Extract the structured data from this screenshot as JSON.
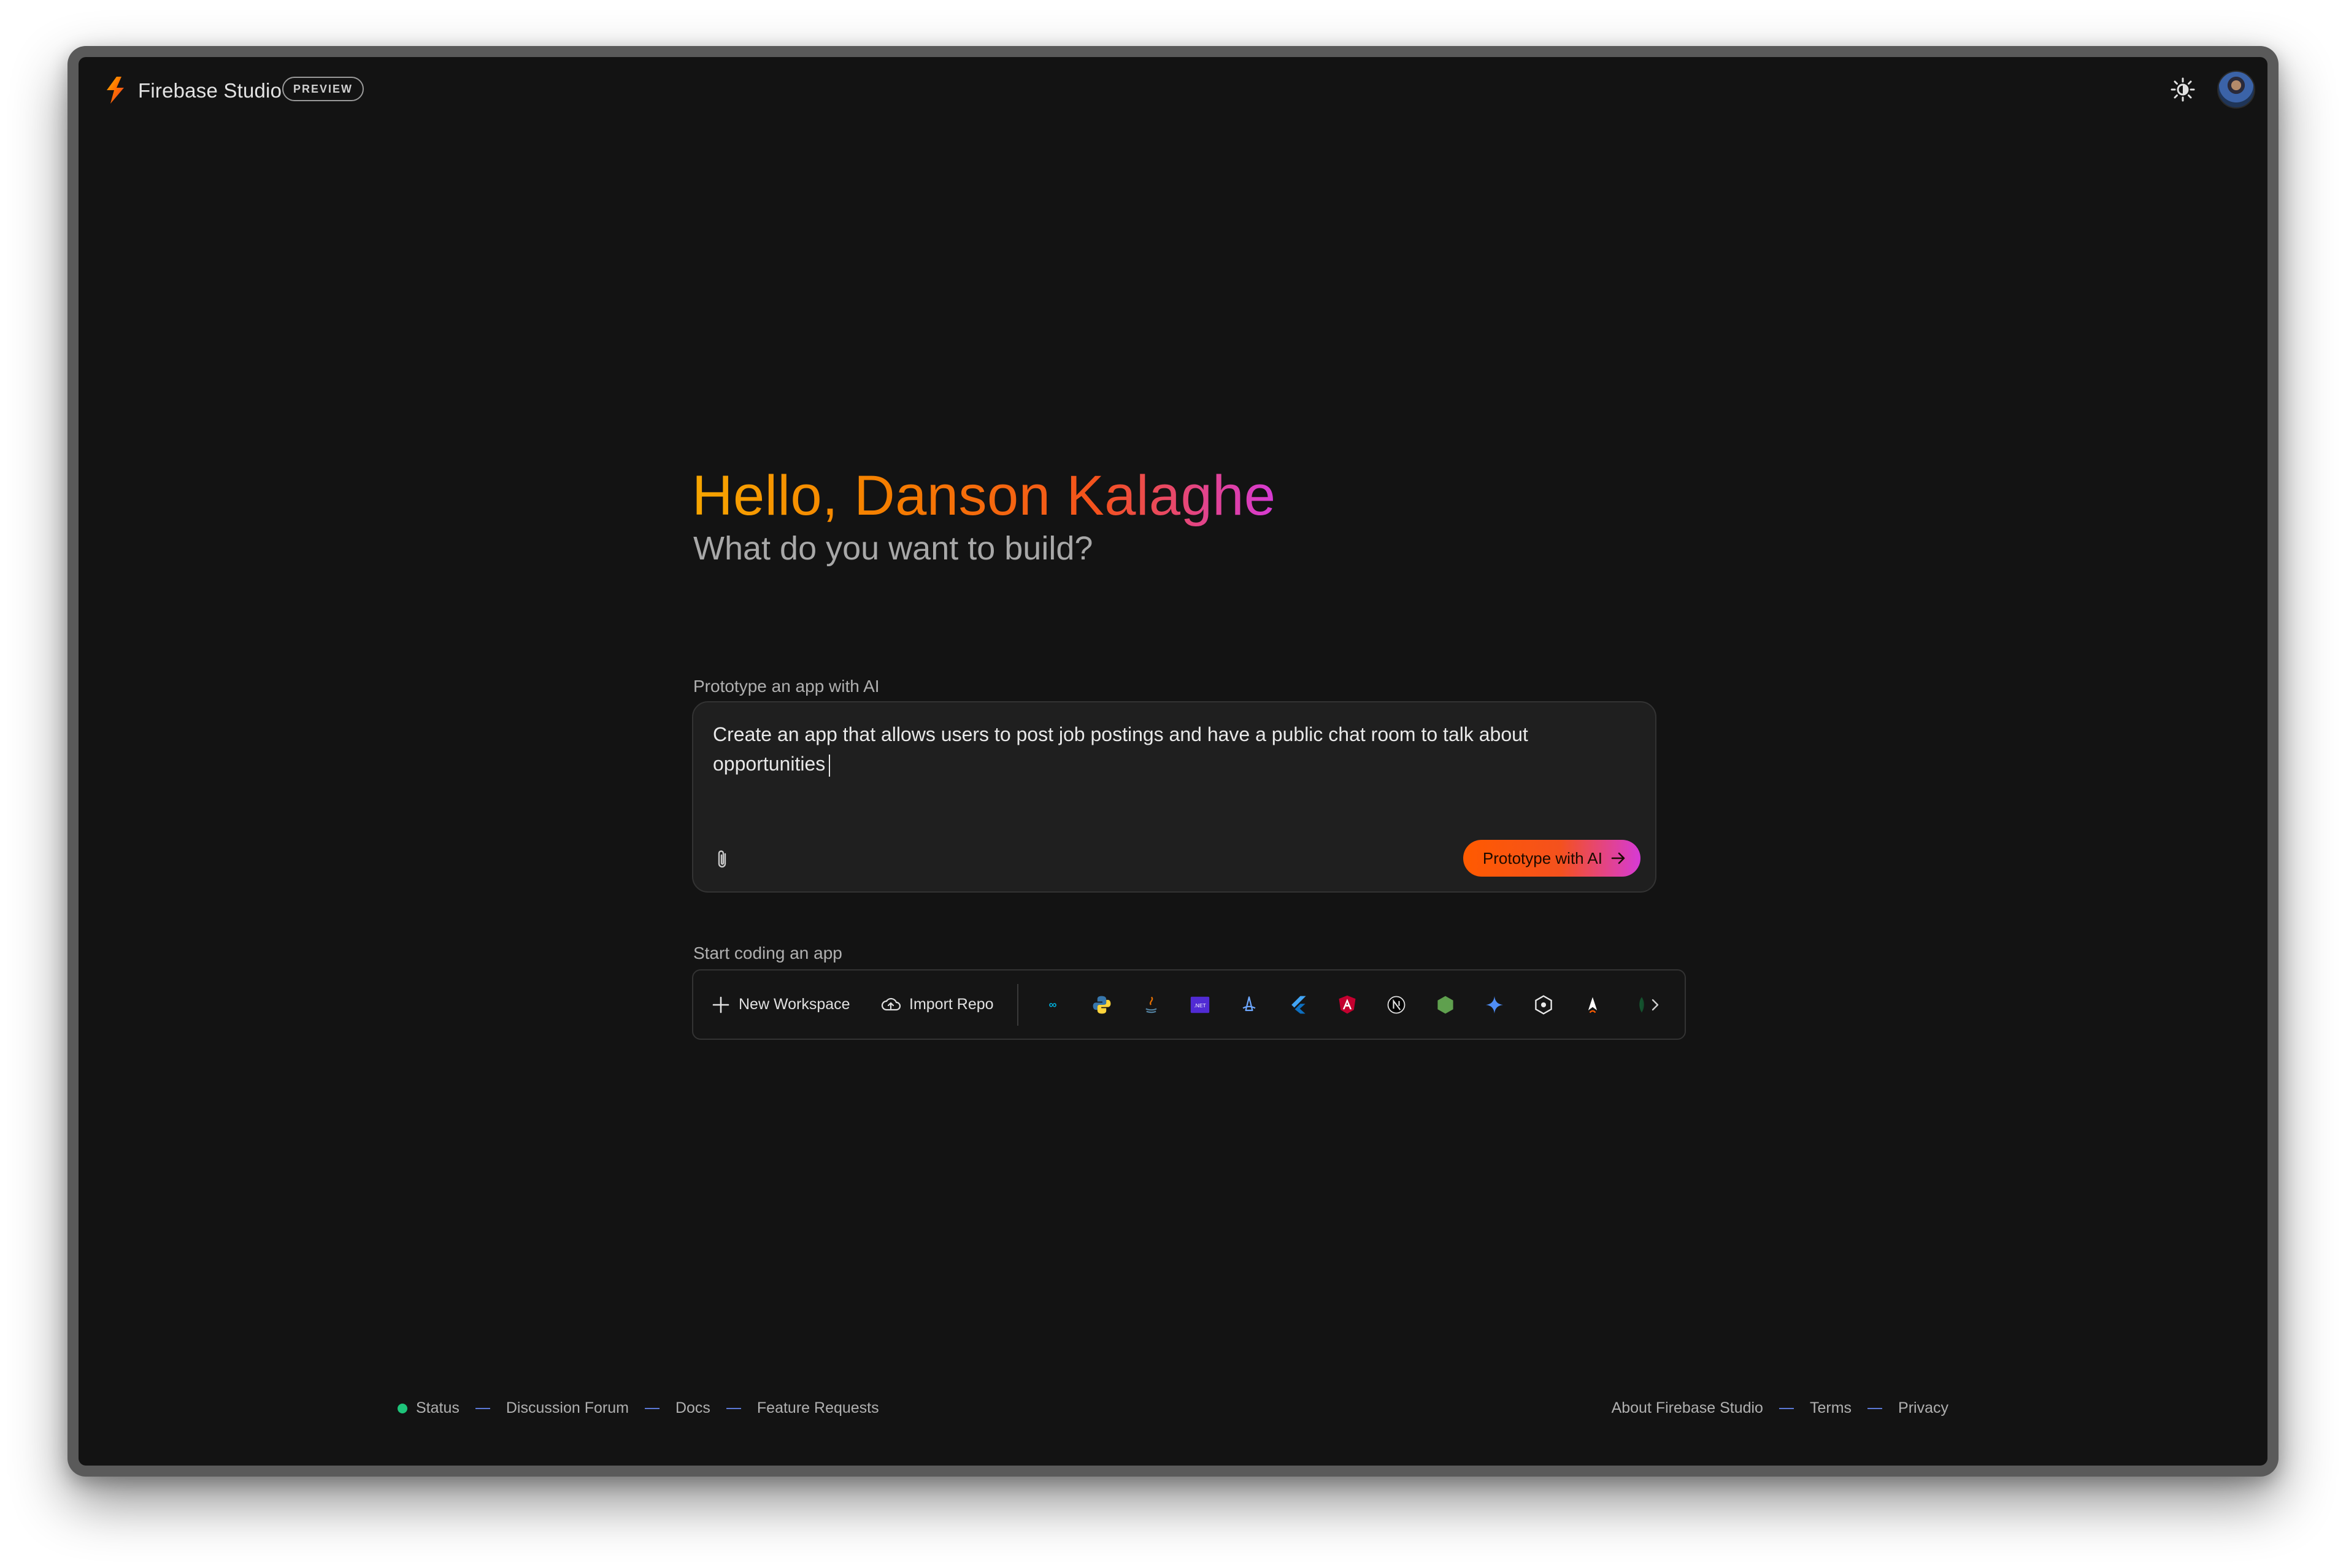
{
  "header": {
    "brand": "Firebase Studio",
    "badge": "PREVIEW",
    "theme_icon": "brightness-icon",
    "avatar": "user-avatar"
  },
  "hero": {
    "greeting": "Hello, Danson Kalaghe",
    "subtitle": "What do you want to build?"
  },
  "prototype": {
    "label": "Prototype an app with AI",
    "prompt_value": "Create an app that allows users to post job postings and have a public chat room to talk about opportunities",
    "attach_icon": "paperclip-icon",
    "button_label": "Prototype with AI"
  },
  "coding": {
    "label": "Start coding an app",
    "new_workspace": "New Workspace",
    "import_repo": "Import Repo",
    "templates": [
      "go-icon",
      "python-icon",
      "java-icon",
      "dotnet-icon",
      "astro-icon",
      "flutter-icon",
      "angular-icon",
      "nextjs-icon",
      "nodejs-icon",
      "gemini-icon",
      "hexagon-icon",
      "astro-a-icon",
      "mongodb-icon"
    ]
  },
  "footer": {
    "left": [
      "Status",
      "Discussion Forum",
      "Docs",
      "Feature Requests"
    ],
    "right": [
      "About Firebase Studio",
      "Terms",
      "Privacy"
    ]
  },
  "colors": {
    "background": "#131313",
    "accent_start": "#f7a600",
    "accent_end": "#d63ad6",
    "status_green": "#1ec47a"
  }
}
